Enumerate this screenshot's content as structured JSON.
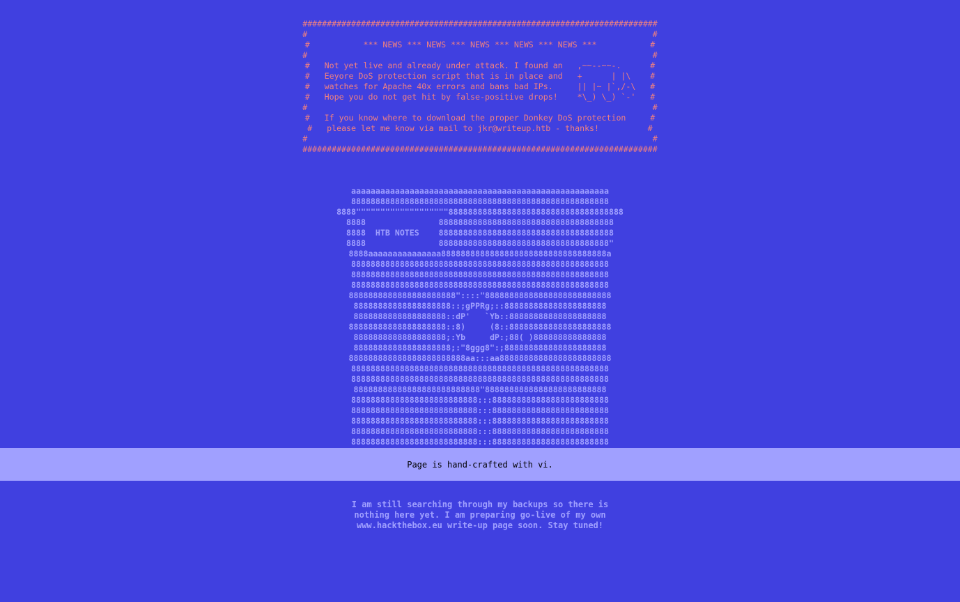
{
  "colors": {
    "background": "#4040e0",
    "news_text": "#f08080",
    "ascii_art": "#a0a0ff",
    "footer_bg": "#a0a0ff",
    "footer_text": "#000000",
    "status_text": "#a0a0ff"
  },
  "news_box": {
    "lines": [
      "#########################################################################",
      "#                                                                       #",
      "#           *** NEWS *** NEWS *** NEWS *** NEWS *** NEWS ***           #",
      "#                                                                       #",
      "#   Not yet live and already under attack. I found an   ,~~--~~-.      #",
      "#   Eeyore DoS protection script that is in place and   +      | |\\    #",
      "#   watches for Apache 40x errors and bans bad IPs.     || |~ |`,/-\\   #",
      "#   Hope you do not get hit by false-positive drops!    *\\_) \\_) `-'   #",
      "#                                                                       #",
      "#   If you know where to download the proper Donkey DoS protection     #",
      "#   please let me know via mail to jkr@writeup.htb - thanks!          #",
      "#                                                                       #",
      "#########################################################################"
    ]
  },
  "logo": {
    "lines": [
      "aaaaaaaaaaaaaaaaaaaaaaaaaaaaaaaaaaaaaaaaaaaaaaaaaaaaa",
      "88888888888888888888888888888888888888888888888888888",
      "8888\"\"\"\"\"\"\"\"\"\"\"\"\"\"\"\"\"\"\"888888888888888888888888888888888888",
      "8888               888888888888888888888888888888888888",
      "8888  HTB NOTES    888888888888888888888888888888888888",
      "8888               88888888888888888888888888888888888\"",
      "8888aaaaaaaaaaaaaaa8888888888888888888888888888888888a",
      "88888888888888888888888888888888888888888888888888888",
      "88888888888888888888888888888888888888888888888888888",
      "88888888888888888888888888888888888888888888888888888",
      "8888888888888888888888\"::::\"88888888888888888888888888",
      "88888888888888888888::;gPPRg;::888888888888888888888",
      "8888888888888888888::dP'   `Yb::88888888888888888888",
      "88888888888888888888::8)     (8::888888888888888888888",
      "8888888888888888888;:Yb     dP:;88( )888888888888888",
      "88888888888888888888;:\"8ggg8\":;888888888888888888888",
      "888888888888888888888888aa:::aa88888888888888888888888",
      "88888888888888888888888888888888888888888888888888888",
      "88888888888888888888888888888888888888888888888888888",
      "88888888888888888888888888\"8888888888888888888888888",
      "88888888888888888888888888:::888888888888888888888888",
      "88888888888888888888888888:::888888888888888888888888",
      "88888888888888888888888888:::888888888888888888888888",
      "88888888888888888888888888:::888888888888888888888888",
      "88888888888888888888888888:::888888888888888888888888"
    ]
  },
  "footer": {
    "text": "Page is hand-crafted with vi."
  },
  "status": {
    "lines": [
      "I am still searching through my backups so there is",
      "nothing here yet. I am preparing go-live of my own",
      "www.hackthebox.eu write-up page soon. Stay tuned!"
    ]
  }
}
